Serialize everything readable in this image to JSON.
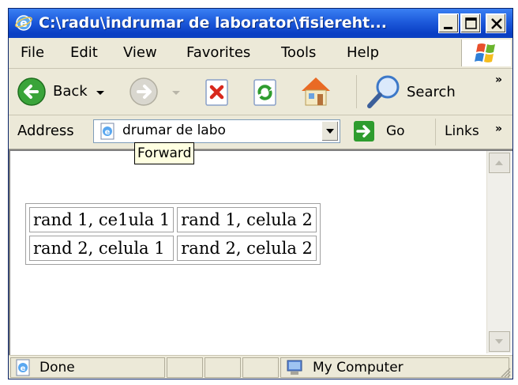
{
  "window": {
    "title": "C:\\radu\\indrumar de laborator\\fisiereht...",
    "controls": [
      "minimize",
      "maximize",
      "close"
    ]
  },
  "menu": {
    "items": [
      {
        "label": "File"
      },
      {
        "label": "Edit"
      },
      {
        "label": "View"
      },
      {
        "label": "Favorites"
      },
      {
        "label": "Tools"
      },
      {
        "label": "Help"
      }
    ],
    "logo_icon": "windows-flag-icon"
  },
  "toolbar": {
    "back_label": "Back",
    "search_label": "Search",
    "more": "»",
    "icons": [
      "back-arrow-icon",
      "forward-arrow-icon",
      "stop-icon",
      "refresh-icon",
      "home-icon",
      "search-magnifier-icon"
    ]
  },
  "address": {
    "label": "Address",
    "value": "drumar de labo",
    "go_label": "Go",
    "links_label": "Links",
    "links_more": "»"
  },
  "tooltip": {
    "text": "Forward"
  },
  "page": {
    "table": [
      [
        "rand 1, ce1ula 1",
        "rand 1, celula 2"
      ],
      [
        "rand 2, celula 1",
        "rand 2, celula 2"
      ]
    ]
  },
  "status": {
    "text": "Done",
    "zone": "My Computer"
  },
  "colors": {
    "titlebar": "#0a3fc4",
    "chrome": "#ece9d8",
    "go_green": "#2e9c2e",
    "tooltip_bg": "#ffffe1"
  }
}
